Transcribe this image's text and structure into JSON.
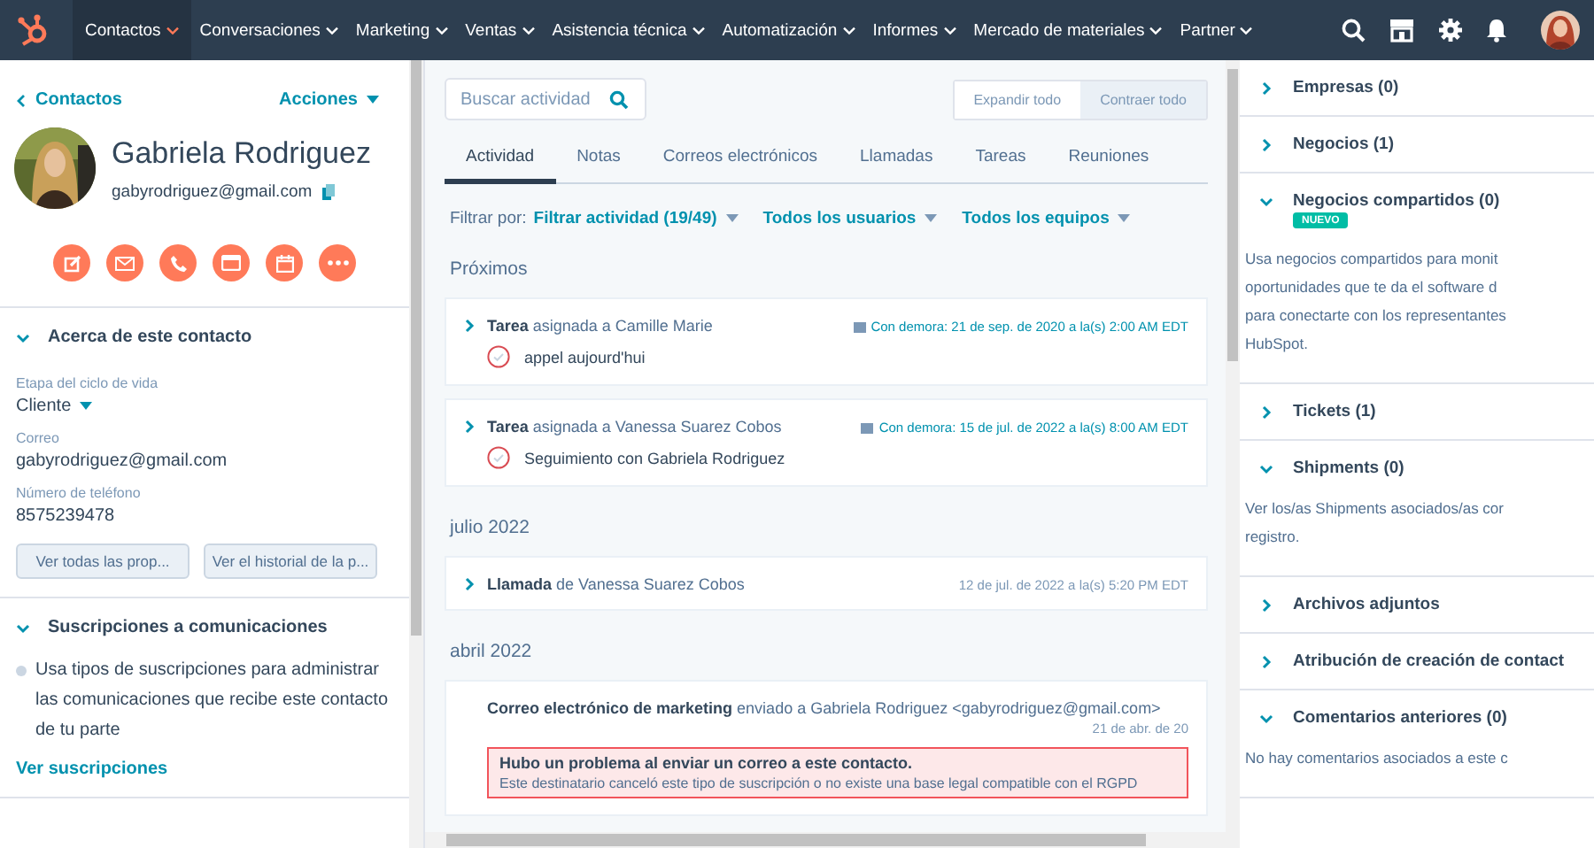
{
  "nav": {
    "items": [
      {
        "label": "Contactos",
        "selected": true
      },
      {
        "label": "Conversaciones",
        "selected": false
      },
      {
        "label": "Marketing",
        "selected": false
      },
      {
        "label": "Ventas",
        "selected": false
      },
      {
        "label": "Asistencia técnica",
        "selected": false
      },
      {
        "label": "Automatización",
        "selected": false
      },
      {
        "label": "Informes",
        "selected": false
      },
      {
        "label": "Mercado de materiales",
        "selected": false
      },
      {
        "label": "Partner",
        "selected": false
      }
    ]
  },
  "contact": {
    "back_link": "Contactos",
    "actions": "Acciones",
    "name": "Gabriela Rodriguez",
    "email": "gabyrodriguez@gmail.com"
  },
  "about": {
    "title": "Acerca de este contacto",
    "expanded": true,
    "fields": [
      {
        "label": "Etapa del ciclo de vida",
        "value": "Cliente",
        "kind": "dropdown"
      },
      {
        "label": "Correo",
        "value": "gabyrodriguez@gmail.com",
        "kind": "text"
      },
      {
        "label": "Número de teléfono",
        "value": "8575239478",
        "kind": "text"
      }
    ],
    "buttons": [
      "Ver todas las prop...",
      "Ver el historial de la p..."
    ]
  },
  "subscriptions": {
    "title": "Suscripciones a comunicaciones",
    "expanded": true,
    "text": "Usa tipos de suscripciones para administrar las comunicaciones que recibe este contacto de tu parte",
    "link": "Ver suscripciones"
  },
  "activity": {
    "search": {
      "placeholder": "Buscar actividad"
    },
    "toggles": [
      {
        "label": "Expandir todo",
        "selected": false
      },
      {
        "label": "Contraer todo",
        "selected": true
      }
    ],
    "tabs": [
      {
        "label": "Actividad",
        "selected": true
      },
      {
        "label": "Notas",
        "selected": false
      },
      {
        "label": "Correos electrónicos",
        "selected": false
      },
      {
        "label": "Llamadas",
        "selected": false
      },
      {
        "label": "Tareas",
        "selected": false
      },
      {
        "label": "Reuniones",
        "selected": false
      }
    ],
    "filter_label": "Filtrar por:",
    "filters": [
      "Filtrar actividad (19/49)",
      "Todos los usuarios",
      "Todos los equipos"
    ],
    "sections": [
      {
        "heading": "Próximos",
        "items": [
          {
            "kind": "task",
            "title": "**Tarea** asignada a Camille Marie",
            "subject": "appel aujourd'hui",
            "completed": false,
            "date": "Con demora: 21 de sep. de 2020 a la(s) 2:00 AM EDT",
            "overdue": true
          },
          {
            "kind": "task",
            "title": "**Tarea** asignada a Vanessa Suarez Cobos",
            "subject": "Seguimiento con Gabriela Rodriguez",
            "completed": false,
            "date": "Con demora: 15 de jul. de 2022 a la(s) 8:00 AM EDT",
            "overdue": true
          }
        ]
      },
      {
        "heading": "julio 2022",
        "items": [
          {
            "kind": "call",
            "title": "**Llamada** de Vanessa Suarez Cobos",
            "date": "12 de jul. de 2022 a la(s) 5:20 PM EDT",
            "overdue": false
          }
        ]
      },
      {
        "heading": "abril 2022",
        "items": [
          {
            "kind": "email",
            "title": "**Correo electrónico de marketing** enviado a Gabriela Rodriguez <gabyrodriguez@gmail.com>",
            "date": "21 de abr. de 20",
            "overdue": false,
            "alert": {
              "title": "Hubo un problema al enviar un correo a este contacto.",
              "text": "Este destinatario canceló este tipo de suscripción o no existe una base legal compatible con el RGPD"
            }
          }
        ]
      }
    ]
  },
  "sidebar": {
    "sections": [
      {
        "title": "Empresas (0)",
        "expanded": false
      },
      {
        "title": "Negocios (1)",
        "expanded": false
      },
      {
        "title": "Negocios compartidos (0)",
        "expanded": true,
        "badge": "NUEVO",
        "lines": [
          "Usa negocios compartidos para monit",
          "oportunidades que te da el software d",
          "para conectarte con los representantes",
          "HubSpot."
        ]
      },
      {
        "title": "Tickets (1)",
        "expanded": false
      },
      {
        "title": "Shipments (0)",
        "expanded": true,
        "lines": [
          "Ver los/as Shipments asociados/as cor",
          "registro."
        ]
      },
      {
        "title": "Archivos adjuntos",
        "expanded": false
      },
      {
        "title": "Atribución de creación de contact",
        "expanded": false
      },
      {
        "title": "Comentarios anteriores (0)",
        "expanded": true,
        "lines": [
          "No hay comentarios asociados a este c"
        ]
      }
    ]
  }
}
